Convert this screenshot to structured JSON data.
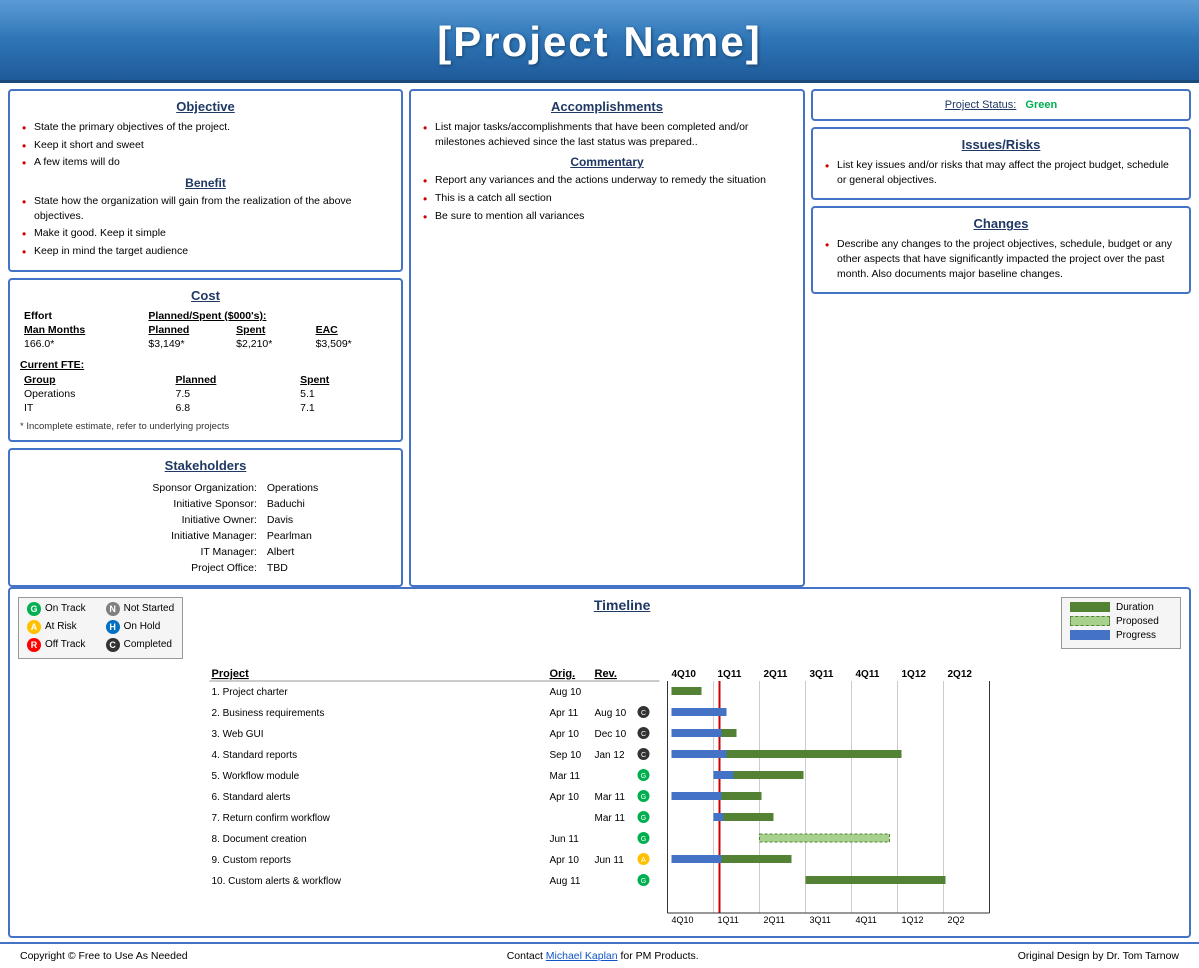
{
  "header": {
    "title": "[Project Name]"
  },
  "objective": {
    "title": "Objective",
    "items": [
      "State the primary objectives of the project.",
      "Keep it short and sweet",
      "A few items will do"
    ]
  },
  "benefit": {
    "title": "Benefit",
    "items": [
      "State how the organization will gain from the realization of the above objectives.",
      "Make it good. Keep it simple",
      "Keep in mind the target audience"
    ]
  },
  "accomplishments": {
    "title": "Accomplishments",
    "items": [
      "List major tasks/accomplishments that have been completed and/or milestones achieved since the last status was prepared.."
    ]
  },
  "commentary": {
    "title": "Commentary",
    "items": [
      "Report any variances and the actions underway to remedy the situation",
      "This is a catch all section",
      "Be sure to mention all variances"
    ]
  },
  "project_status": {
    "title": "Project Status:",
    "value": "Green"
  },
  "issues_risks": {
    "title": "Issues/Risks",
    "items": [
      "List key issues and/or risks that may affect the project budget, schedule or general objectives."
    ]
  },
  "changes": {
    "title": "Changes",
    "items": [
      "Describe any changes to the project objectives, schedule, budget or any other aspects that have significantly impacted the project over the past month. Also documents major baseline changes."
    ]
  },
  "cost": {
    "title": "Cost",
    "effort_label": "Effort",
    "planned_spent_label": "Planned/Spent ($000's):",
    "columns": [
      "Man Months",
      "Planned",
      "Spent",
      "EAC"
    ],
    "row": [
      "166.0*",
      "$3,149*",
      "$2,210*",
      "$3,509*"
    ],
    "fte_label": "Current FTE:",
    "fte_columns": [
      "Group",
      "Planned",
      "Spent"
    ],
    "fte_rows": [
      [
        "Operations",
        "7.5",
        "5.1"
      ],
      [
        "IT",
        "6.8",
        "7.1"
      ]
    ],
    "footnote": "* Incomplete estimate, refer to underlying projects"
  },
  "stakeholders": {
    "title": "Stakeholders",
    "rows": [
      [
        "Sponsor Organization:",
        "Operations"
      ],
      [
        "Initiative Sponsor:",
        "Baduchi"
      ],
      [
        "Initiative Owner:",
        "Davis"
      ],
      [
        "Initiative Manager:",
        "Pearlman"
      ],
      [
        "IT Manager:",
        "Albert"
      ],
      [
        "Project Office:",
        "TBD"
      ]
    ]
  },
  "timeline": {
    "title": "Timeline",
    "legend_left": [
      {
        "symbol": "G",
        "color": "#00b050",
        "label": "On Track"
      },
      {
        "symbol": "A",
        "color": "#ffc000",
        "label": "At Risk"
      },
      {
        "symbol": "R",
        "color": "#ff0000",
        "label": "Off Track"
      },
      {
        "symbol": "N",
        "color": "#808080",
        "label": "Not Started"
      },
      {
        "symbol": "H",
        "color": "#0070c0",
        "label": "On Hold"
      },
      {
        "symbol": "C",
        "color": "#000000",
        "label": "Completed"
      }
    ],
    "legend_right": [
      {
        "bar_type": "duration",
        "label": "Duration"
      },
      {
        "bar_type": "proposed",
        "label": "Proposed"
      },
      {
        "bar_type": "progress",
        "label": "Progress"
      }
    ],
    "columns": [
      "Project",
      "Orig.",
      "Rev."
    ],
    "projects": [
      {
        "name": "1. Project charter",
        "orig": "Aug 10",
        "rev": "",
        "status": "",
        "bars": {
          "type": "short",
          "col": 0
        }
      },
      {
        "name": "2. Business requirements",
        "orig": "Apr 11",
        "rev": "Aug 10",
        "status": "C",
        "bars": {
          "type": "medium",
          "col": 0
        }
      },
      {
        "name": "3. Web GUI",
        "orig": "Apr 10",
        "rev": "Dec 10",
        "status": "C",
        "bars": {
          "type": "medium-long",
          "col": 0
        }
      },
      {
        "name": "4. Standard reports",
        "orig": "Sep 10",
        "rev": "Jan 12",
        "status": "C",
        "bars": {
          "type": "long",
          "col": 0
        }
      },
      {
        "name": "5. Workflow module",
        "orig": "Mar 11",
        "rev": "",
        "status": "G",
        "bars": {
          "type": "medium",
          "col": 1
        }
      },
      {
        "name": "6. Standard alerts",
        "orig": "Apr 10",
        "rev": "Mar 11",
        "status": "G",
        "bars": {
          "type": "medium-long",
          "col": 1
        }
      },
      {
        "name": "7. Return confirm workflow",
        "orig": "",
        "rev": "Mar 11",
        "status": "G",
        "bars": {
          "type": "medium",
          "col": 1
        }
      },
      {
        "name": "8. Document creation",
        "orig": "Jun 11",
        "rev": "",
        "status": "G",
        "bars": {
          "type": "long-green",
          "col": 1
        }
      },
      {
        "name": "9. Custom reports",
        "orig": "Apr 10",
        "rev": "Jun 11",
        "status": "A",
        "bars": {
          "type": "medium-green",
          "col": 1
        }
      },
      {
        "name": "10. Custom alerts & workflow",
        "orig": "Aug 11",
        "rev": "",
        "status": "G",
        "bars": {
          "type": "long2",
          "col": 2
        }
      }
    ],
    "x_labels": [
      "4Q10",
      "1Q11",
      "2Q11",
      "3Q11",
      "4Q11",
      "1Q12",
      "2Q12"
    ]
  },
  "footer": {
    "copyright": "Copyright © Free to Use As Needed",
    "contact_text": "Contact ",
    "contact_link_text": "Michael Kaplan",
    "contact_link_href": "#",
    "contact_suffix": " for PM Products.",
    "design_credit": "Original Design by Dr. Tom Tarnow"
  }
}
